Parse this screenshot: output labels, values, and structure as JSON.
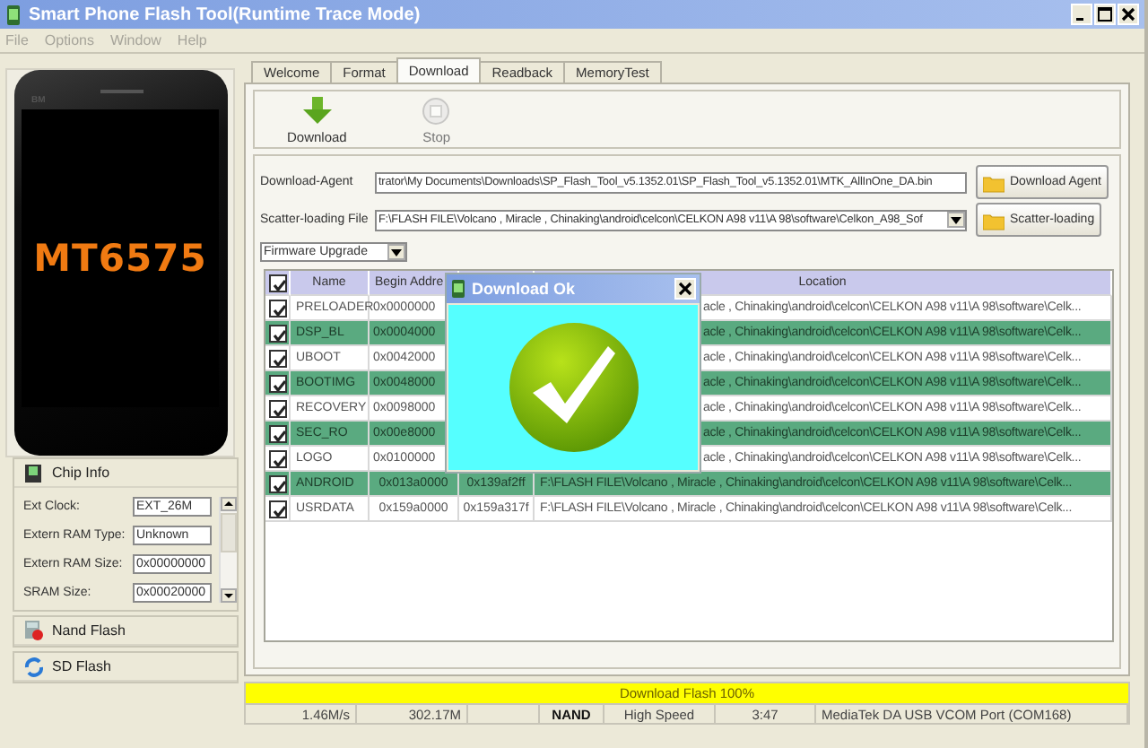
{
  "window": {
    "title": "Smart Phone Flash Tool(Runtime Trace Mode)"
  },
  "menu": [
    {
      "label": "File",
      "disabled": true
    },
    {
      "label": "Options",
      "disabled": true
    },
    {
      "label": "Window",
      "disabled": true
    },
    {
      "label": "Help",
      "disabled": true
    }
  ],
  "phone": {
    "brand": "BM",
    "chip": "MT6575"
  },
  "side_sections": [
    {
      "label": "Chip Info",
      "kind": "chip",
      "fields": [
        {
          "label": "Ext Clock:",
          "value": "EXT_26M"
        },
        {
          "label": "Extern RAM Type:",
          "value": "Unknown"
        },
        {
          "label": "Extern RAM Size:",
          "value": "0x00000000"
        },
        {
          "label": "SRAM Size:",
          "value": "0x00020000"
        }
      ]
    },
    {
      "label": "Nand Flash",
      "kind": "nand"
    },
    {
      "label": "SD Flash",
      "kind": "sd"
    }
  ],
  "tabs": [
    {
      "label": "Welcome",
      "selected": false
    },
    {
      "label": "Format",
      "selected": false
    },
    {
      "label": "Download",
      "selected": true
    },
    {
      "label": "Readback",
      "selected": false
    },
    {
      "label": "MemoryTest",
      "selected": false
    }
  ],
  "toolbar": [
    {
      "label": "Download",
      "kind": "download",
      "disabled": false
    },
    {
      "label": "Stop",
      "kind": "stop",
      "disabled": true
    }
  ],
  "download_agent": {
    "label": "Download-Agent",
    "value": "trator\\My Documents\\Downloads\\SP_Flash_Tool_v5.1352.01\\SP_Flash_Tool_v5.1352.01\\MTK_AllInOne_DA.bin",
    "button": "Download Agent"
  },
  "scatter": {
    "label": "Scatter-loading File",
    "value": "F:\\FLASH FILE\\Volcano , Miracle , Chinaking\\android\\celcon\\CELKON A98 v11\\A 98\\software\\Celkon_A98_Sof",
    "button": "Scatter-loading"
  },
  "mode_select": {
    "value": "Firmware Upgrade"
  },
  "table": {
    "all_checked": true,
    "columns": {
      "name": "Name",
      "begin": "Begin Addre",
      "location": "Location"
    },
    "rows": [
      {
        "checked": true,
        "name": "PRELOADER",
        "begin": "0x0000000",
        "location": "acle , Chinaking\\android\\celcon\\CELKON A98 v11\\A 98\\software\\Celk..."
      },
      {
        "checked": true,
        "name": "DSP_BL",
        "begin": "0x0004000",
        "location": "acle , Chinaking\\android\\celcon\\CELKON A98 v11\\A 98\\software\\Celk..."
      },
      {
        "checked": true,
        "name": "UBOOT",
        "begin": "0x0042000",
        "location": "acle , Chinaking\\android\\celcon\\CELKON A98 v11\\A 98\\software\\Celk..."
      },
      {
        "checked": true,
        "name": "BOOTIMG",
        "begin": "0x0048000",
        "location": "acle , Chinaking\\android\\celcon\\CELKON A98 v11\\A 98\\software\\Celk..."
      },
      {
        "checked": true,
        "name": "RECOVERY",
        "begin": "0x0098000",
        "location": "acle , Chinaking\\android\\celcon\\CELKON A98 v11\\A 98\\software\\Celk..."
      },
      {
        "checked": true,
        "name": "SEC_RO",
        "begin": "0x00e8000",
        "location": "acle , Chinaking\\android\\celcon\\CELKON A98 v11\\A 98\\software\\Celk..."
      },
      {
        "checked": true,
        "name": "LOGO",
        "begin": "0x0100000",
        "location": "acle , Chinaking\\android\\celcon\\CELKON A98 v11\\A 98\\software\\Celk..."
      },
      {
        "checked": true,
        "name": "ANDROID",
        "begin": "0x013a0000",
        "end": "0x139af2ff",
        "location": "F:\\FLASH FILE\\Volcano , Miracle , Chinaking\\android\\celcon\\CELKON A98 v11\\A 98\\software\\Celk..."
      },
      {
        "checked": true,
        "name": "USRDATA",
        "begin": "0x159a0000",
        "end": "0x159a317f",
        "location": "F:\\FLASH FILE\\Volcano , Miracle , Chinaking\\android\\celcon\\CELKON A98 v11\\A 98\\software\\Celk..."
      }
    ]
  },
  "dialog": {
    "title": "Download Ok"
  },
  "progress": {
    "label": "Download Flash 100%",
    "level": 1
  },
  "status_bar": [
    {
      "text": "1.46M/s",
      "bold": false
    },
    {
      "text": "302.17M",
      "bold": false
    },
    {
      "text": "NAND",
      "bold": true
    },
    {
      "text": "High Speed",
      "bold": false
    },
    {
      "text": "3:47",
      "bold": false
    },
    {
      "text": "MediaTek DA USB VCOM Port (COM168)",
      "bold": false
    }
  ]
}
